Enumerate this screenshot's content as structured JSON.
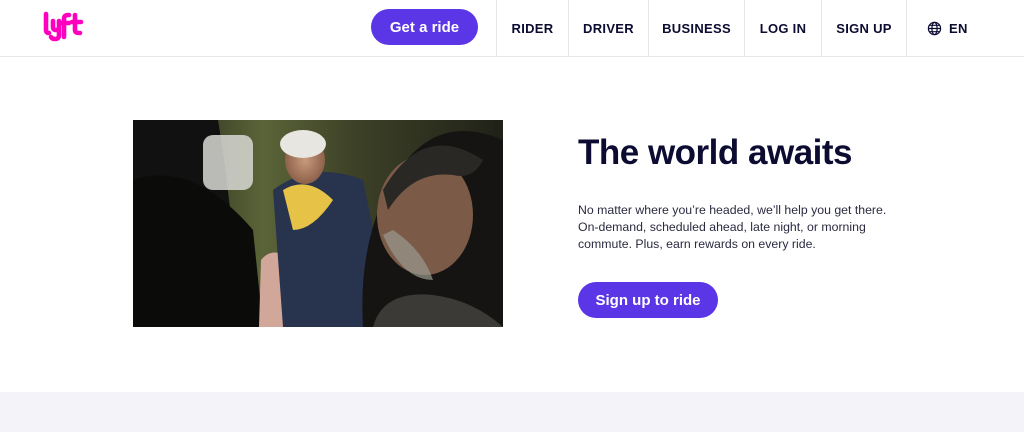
{
  "header": {
    "logo_text": "lyft",
    "get_ride_label": "Get a ride",
    "nav": {
      "rider": "RIDER",
      "driver": "DRIVER",
      "business": "BUSINESS",
      "login": "LOG IN",
      "signup": "SIGN UP",
      "language": "EN",
      "language_icon": "globe-icon"
    }
  },
  "hero": {
    "image_subject": "photo",
    "title": "The world awaits",
    "body_lines": [
      "No matter where you’re headed, we’ll help you get there.",
      "On-demand, scheduled ahead, late night, or morning",
      "commute. Plus, earn rewards on every ride."
    ],
    "cta_label": "Sign up to ride"
  },
  "colors": {
    "brand_pink": "#ff00bf",
    "button_purple": "#5a36e6",
    "text_dark": "#0c0b31",
    "band_gray": "#f3f3f9"
  }
}
